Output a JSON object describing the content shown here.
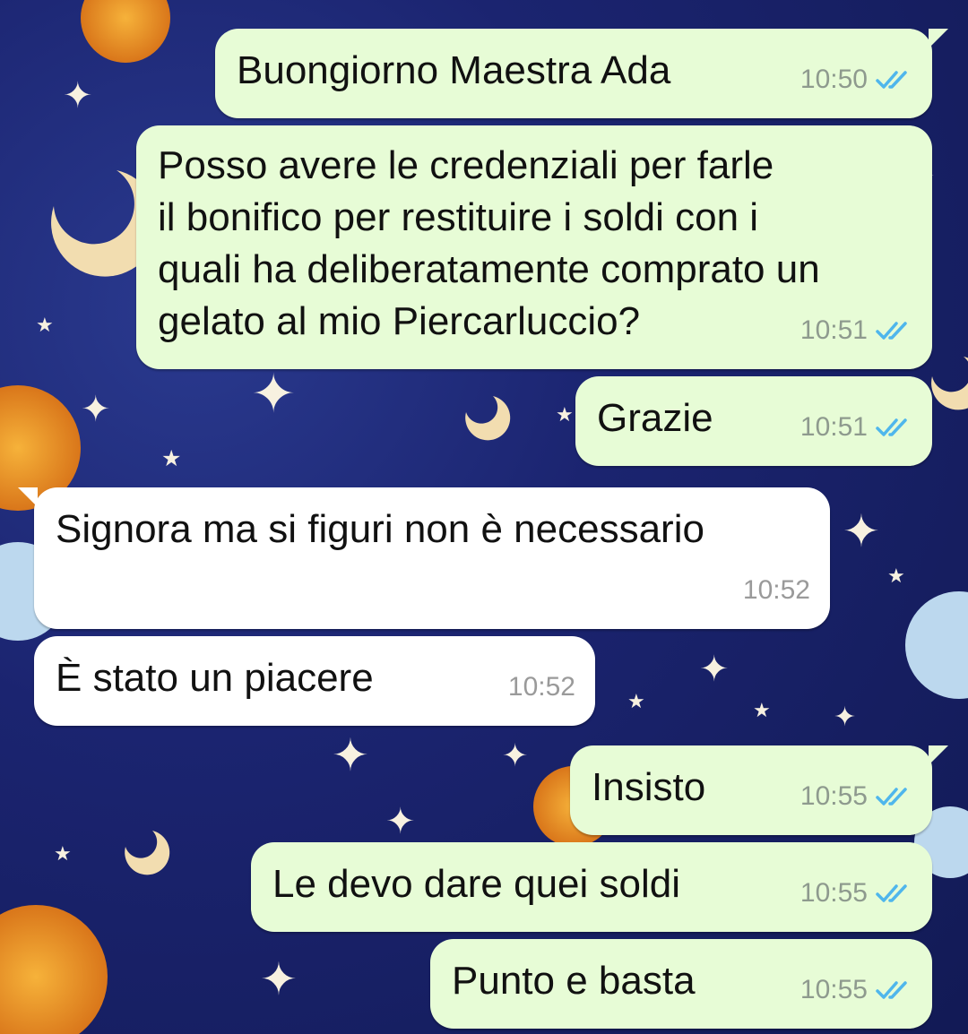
{
  "colors": {
    "outgoing_bubble": "#e7fcd6",
    "incoming_bubble": "#ffffff",
    "read_tick": "#4fb6ec",
    "wallpaper": "#1b2470"
  },
  "messages": [
    {
      "direction": "outgoing",
      "text": "Buongiorno Maestra Ada",
      "time": "10:50",
      "status": "read-ticks-icon"
    },
    {
      "direction": "outgoing",
      "text": "Posso avere le credenziali per farle\nil bonifico per restituire i soldi con i\nquali ha deliberatamente comprato un\ngelato al mio Piercarluccio?",
      "time": "10:51",
      "status": "read-ticks-icon"
    },
    {
      "direction": "outgoing",
      "text": "Grazie",
      "time": "10:51",
      "status": "read-ticks-icon"
    },
    {
      "direction": "incoming",
      "text": "Signora ma si figuri non è necessario",
      "time": "10:52"
    },
    {
      "direction": "incoming",
      "text": "È stato un piacere",
      "time": "10:52"
    },
    {
      "direction": "outgoing",
      "text": "Insisto",
      "time": "10:55",
      "status": "read-ticks-icon"
    },
    {
      "direction": "outgoing",
      "text": "Le devo dare quei soldi",
      "time": "10:55",
      "status": "read-ticks-icon"
    },
    {
      "direction": "outgoing",
      "text": "Punto e basta",
      "time": "10:55",
      "status": "read-ticks-icon"
    }
  ]
}
